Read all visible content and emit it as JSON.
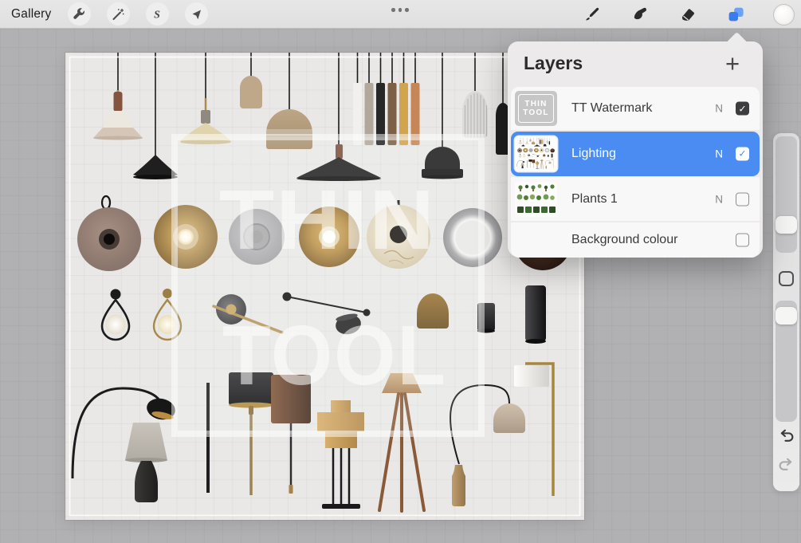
{
  "toolbar": {
    "gallery_label": "Gallery",
    "selection_glyph": "S",
    "left_buttons": [
      "actions",
      "adjustments",
      "selection",
      "transform"
    ],
    "right_buttons": [
      "paint",
      "smudge",
      "erase",
      "layers",
      "color"
    ]
  },
  "layers_panel": {
    "title": "Layers",
    "add_button": "+",
    "layers": [
      {
        "name": "TT Watermark",
        "blend_mode": "N",
        "visible": true,
        "selected": false,
        "thumb_line1": "THIN",
        "thumb_line2": "TOOL"
      },
      {
        "name": "Lighting",
        "blend_mode": "N",
        "visible": true,
        "selected": true
      },
      {
        "name": "Plants 1",
        "blend_mode": "N",
        "visible": false,
        "selected": false
      },
      {
        "name": "Background colour",
        "visible": false,
        "selected": false
      }
    ]
  },
  "canvas": {
    "watermark_line1": "THIN",
    "watermark_line2": "TOOL"
  },
  "sidebar": {
    "controls": [
      "brush-size-slider",
      "modify-button",
      "opacity-slider",
      "undo",
      "redo"
    ]
  },
  "colors": {
    "accent_blue": "#4a8cf2",
    "selected_row": "#4a8cf2",
    "layers_icon_blue": "#3a7bf0",
    "toolbar_bg": "#e5e4e4",
    "stage_bg": "#b1b1b3",
    "canvas_bg": "#e9e8e6",
    "panel_bg": "#eceaea"
  }
}
